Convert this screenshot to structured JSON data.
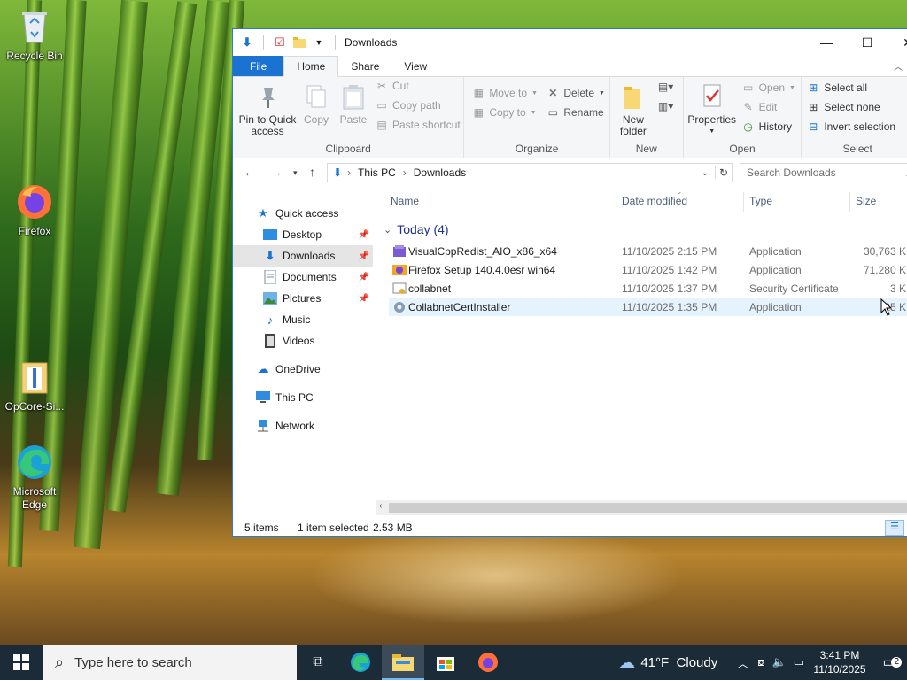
{
  "desktop": {
    "icons": [
      {
        "label": "Recycle Bin",
        "icon": "recycle-bin-icon"
      },
      {
        "label": "Firefox",
        "icon": "firefox-icon"
      },
      {
        "label": "OpCore-Si...",
        "icon": "folder-zip-icon"
      },
      {
        "label": "Microsoft Edge",
        "icon": "edge-icon"
      }
    ]
  },
  "window": {
    "title": "Downloads",
    "controls": {
      "minimize": "—",
      "maximize": "☐",
      "close": "✕"
    }
  },
  "ribbon": {
    "tabs": {
      "file": "File",
      "home": "Home",
      "share": "Share",
      "view": "View"
    },
    "clipboard": {
      "title": "Clipboard",
      "pin": "Pin to Quick access",
      "copy": "Copy",
      "paste": "Paste",
      "cut": "Cut",
      "copy_path": "Copy path",
      "paste_shortcut": "Paste shortcut"
    },
    "organize": {
      "title": "Organize",
      "move_to": "Move to",
      "copy_to": "Copy to",
      "delete": "Delete",
      "rename": "Rename"
    },
    "new": {
      "title": "New",
      "new_folder": "New folder"
    },
    "open": {
      "title": "Open",
      "properties": "Properties",
      "open": "Open",
      "edit": "Edit",
      "history": "History"
    },
    "select": {
      "title": "Select",
      "select_all": "Select all",
      "select_none": "Select none",
      "invert": "Invert selection"
    }
  },
  "address": {
    "crumbs": [
      "This PC",
      "Downloads"
    ],
    "search_placeholder": "Search Downloads"
  },
  "nav": {
    "quick_access": "Quick access",
    "items": [
      {
        "label": "Desktop",
        "icon": "desktop-folder-icon",
        "pinned": true
      },
      {
        "label": "Downloads",
        "icon": "downloads-folder-icon",
        "pinned": true,
        "selected": true
      },
      {
        "label": "Documents",
        "icon": "documents-folder-icon",
        "pinned": true
      },
      {
        "label": "Pictures",
        "icon": "pictures-folder-icon",
        "pinned": true
      },
      {
        "label": "Music",
        "icon": "music-folder-icon",
        "pinned": false
      },
      {
        "label": "Videos",
        "icon": "videos-folder-icon",
        "pinned": false
      }
    ],
    "onedrive": "OneDrive",
    "this_pc": "This PC",
    "network": "Network"
  },
  "files": {
    "columns": {
      "name": "Name",
      "date": "Date modified",
      "type": "Type",
      "size": "Size"
    },
    "group": "Today (4)",
    "rows": [
      {
        "name": "VisualCppRedist_AIO_x86_x64",
        "date": "11/10/2025 2:15 PM",
        "type": "Application",
        "size": "30,763 K",
        "icon": "installer-icon",
        "selected": false
      },
      {
        "name": "Firefox Setup 140.4.0esr win64",
        "date": "11/10/2025 1:42 PM",
        "type": "Application",
        "size": "71,280 K",
        "icon": "firefox-setup-icon",
        "selected": false
      },
      {
        "name": "collabnet",
        "date": "11/10/2025 1:37 PM",
        "type": "Security Certificate",
        "size": "3 K",
        "icon": "certificate-icon",
        "selected": false
      },
      {
        "name": "CollabnetCertInstaller",
        "date": "11/10/2025 1:35 PM",
        "type": "Application",
        "size": "25 K",
        "icon": "application-icon",
        "selected": true
      }
    ]
  },
  "status": {
    "items": "5 items",
    "selected": "1 item selected",
    "size": "2.53 MB"
  },
  "taskbar": {
    "search_placeholder": "Type here to search",
    "weather": "41°F  Cloudy",
    "time": "3:41 PM",
    "date": "11/10/2025",
    "notifications": "2"
  },
  "colors": {
    "accent": "#1a73d1",
    "selection": "#e5f3ff",
    "taskbar": "#1c2b38"
  }
}
